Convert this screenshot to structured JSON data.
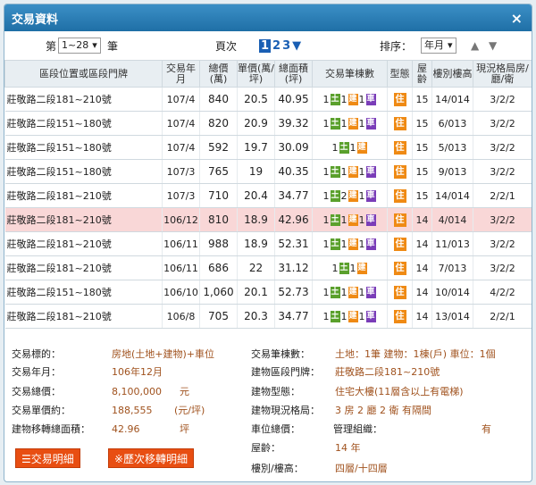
{
  "window": {
    "title": "交易資料",
    "close": "×"
  },
  "controls": {
    "count_prefix": "第",
    "count_select": "1~28",
    "count_suffix": "筆",
    "page_label": "頁次",
    "pages": [
      "1",
      "2",
      "3"
    ],
    "current_page": "1",
    "sort_label": "排序：",
    "sort_select": "年月"
  },
  "columns": [
    "區段位置或區段門牌",
    "交易年月",
    "總價(萬)",
    "單價(萬/坪)",
    "總面積(坪)",
    "交易筆棟數",
    "型態",
    "屋齡",
    "樓別樓高",
    "現況格局房/廳/衛"
  ],
  "rows": [
    {
      "addr": "莊敬路二段181~210號",
      "ym": "107/4",
      "total": "840",
      "unit": "20.5",
      "area": "40.95",
      "c": [
        "1",
        "1",
        "1"
      ],
      "type": "住",
      "age": "15",
      "floor": "14/014",
      "layout": "3/2/2",
      "hl": false
    },
    {
      "addr": "莊敬路二段151~180號",
      "ym": "107/4",
      "total": "820",
      "unit": "20.9",
      "area": "39.32",
      "c": [
        "1",
        "1",
        "1"
      ],
      "type": "住",
      "age": "15",
      "floor": "6/013",
      "layout": "3/2/2",
      "hl": false
    },
    {
      "addr": "莊敬路二段151~180號",
      "ym": "107/4",
      "total": "592",
      "unit": "19.7",
      "area": "30.09",
      "c": [
        "1",
        "1",
        ""
      ],
      "type": "住",
      "age": "15",
      "floor": "5/013",
      "layout": "3/2/2",
      "hl": false
    },
    {
      "addr": "莊敬路二段151~180號",
      "ym": "107/3",
      "total": "765",
      "unit": "19",
      "area": "40.35",
      "c": [
        "1",
        "1",
        "1"
      ],
      "type": "住",
      "age": "15",
      "floor": "9/013",
      "layout": "3/2/2",
      "hl": false
    },
    {
      "addr": "莊敬路二段181~210號",
      "ym": "107/3",
      "total": "710",
      "unit": "20.4",
      "area": "34.77",
      "c": [
        "1",
        "2",
        "1"
      ],
      "type": "住",
      "age": "15",
      "floor": "14/014",
      "layout": "2/2/1",
      "hl": false
    },
    {
      "addr": "莊敬路二段181~210號",
      "ym": "106/12",
      "total": "810",
      "unit": "18.9",
      "area": "42.96",
      "c": [
        "1",
        "1",
        "1"
      ],
      "type": "住",
      "age": "14",
      "floor": "4/014",
      "layout": "3/2/2",
      "hl": true
    },
    {
      "addr": "莊敬路二段181~210號",
      "ym": "106/11",
      "total": "988",
      "unit": "18.9",
      "area": "52.31",
      "c": [
        "1",
        "1",
        "1"
      ],
      "type": "住",
      "age": "14",
      "floor": "11/013",
      "layout": "3/2/2",
      "hl": false
    },
    {
      "addr": "莊敬路二段181~210號",
      "ym": "106/11",
      "total": "686",
      "unit": "22",
      "area": "31.12",
      "c": [
        "1",
        "1",
        ""
      ],
      "type": "住",
      "age": "14",
      "floor": "7/013",
      "layout": "3/2/2",
      "hl": false
    },
    {
      "addr": "莊敬路二段151~180號",
      "ym": "106/10",
      "total": "1,060",
      "unit": "20.1",
      "area": "52.73",
      "c": [
        "1",
        "1",
        "1"
      ],
      "type": "住",
      "age": "14",
      "floor": "10/014",
      "layout": "4/2/2",
      "hl": false
    },
    {
      "addr": "莊敬路二段181~210號",
      "ym": "106/8",
      "total": "705",
      "unit": "20.3",
      "area": "34.77",
      "c": [
        "1",
        "1",
        "1"
      ],
      "type": "住",
      "age": "14",
      "floor": "13/014",
      "layout": "2/2/1",
      "hl": false
    }
  ],
  "badges": {
    "land": "土",
    "bldg": "建",
    "car": "車",
    "type": "住"
  },
  "detail": {
    "target_label": "交易標的：",
    "target": "房地(土地+建物)+車位",
    "ym_label": "交易年月：",
    "ym": "106年12月",
    "total_label": "交易總價：",
    "total": "8,100,000",
    "total_unit": "元",
    "unit_label": "交易單價約：",
    "unit": "188,555",
    "unit_unit": "(元/坪)",
    "area_label": "建物移轉總面積：",
    "area": "42.96",
    "area_unit": "坪",
    "count_label": "交易筆棟數：",
    "count": "土地：1筆 建物：1棟(戶) 車位：1個",
    "addr_label": "建物區段門牌：",
    "addr": "莊敬路二段181~210號",
    "btype_label": "建物型態：",
    "btype": "住宅大樓(11層含以上有電梯)",
    "layout_label": "建物現況格局：",
    "layout": "3 房 2 廳 2 衛 有隔間",
    "car_label": "車位總價：",
    "car": "",
    "mgmt_label": "管理組織：",
    "mgmt": "有",
    "age_label": "屋齡：",
    "age": "14 年",
    "floor_label": "樓別/樓高：",
    "floor": "四層/十四層",
    "btn1": "☰交易明細",
    "btn2": "※歷次移轉明細"
  }
}
